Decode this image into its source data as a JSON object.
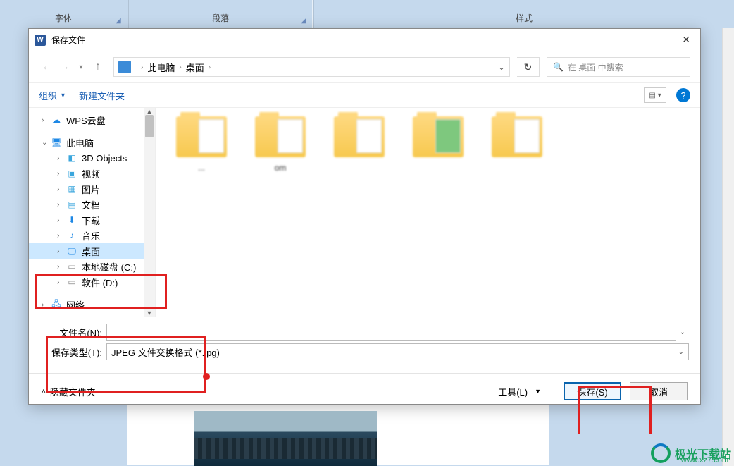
{
  "ribbon": {
    "font": "字体",
    "para": "段落",
    "style": "样式"
  },
  "dialog": {
    "title": "保存文件",
    "breadcrumb": {
      "pc": "此电脑",
      "desktop": "桌面"
    },
    "search_placeholder": "在 桌面 中搜索",
    "organize": "组织",
    "newfolder": "新建文件夹",
    "tree": {
      "wps": "WPS云盘",
      "thispc": "此电脑",
      "objects3d": "3D Objects",
      "video": "视频",
      "pictures": "图片",
      "docs": "文档",
      "downloads": "下载",
      "music": "音乐",
      "desktop": "桌面",
      "cdrive": "本地磁盘 (C:)",
      "ddrive": "软件 (D:)",
      "network": "网络"
    },
    "folders": {
      "f1": "...",
      "f2": "om",
      "f3": " ",
      "f4": " ",
      "f5": " "
    },
    "filename_label": "文件名(N):",
    "filename_value": "",
    "filetype_label": "保存类型(T):",
    "filetype_value": "JPEG 文件交换格式 (*.jpg)",
    "hide_folders": "隐藏文件夹",
    "tools": "工具(L)",
    "save": "保存(S)",
    "cancel": "取消"
  },
  "watermark": {
    "text": "极光下载站",
    "url": "www.xz7.com"
  }
}
